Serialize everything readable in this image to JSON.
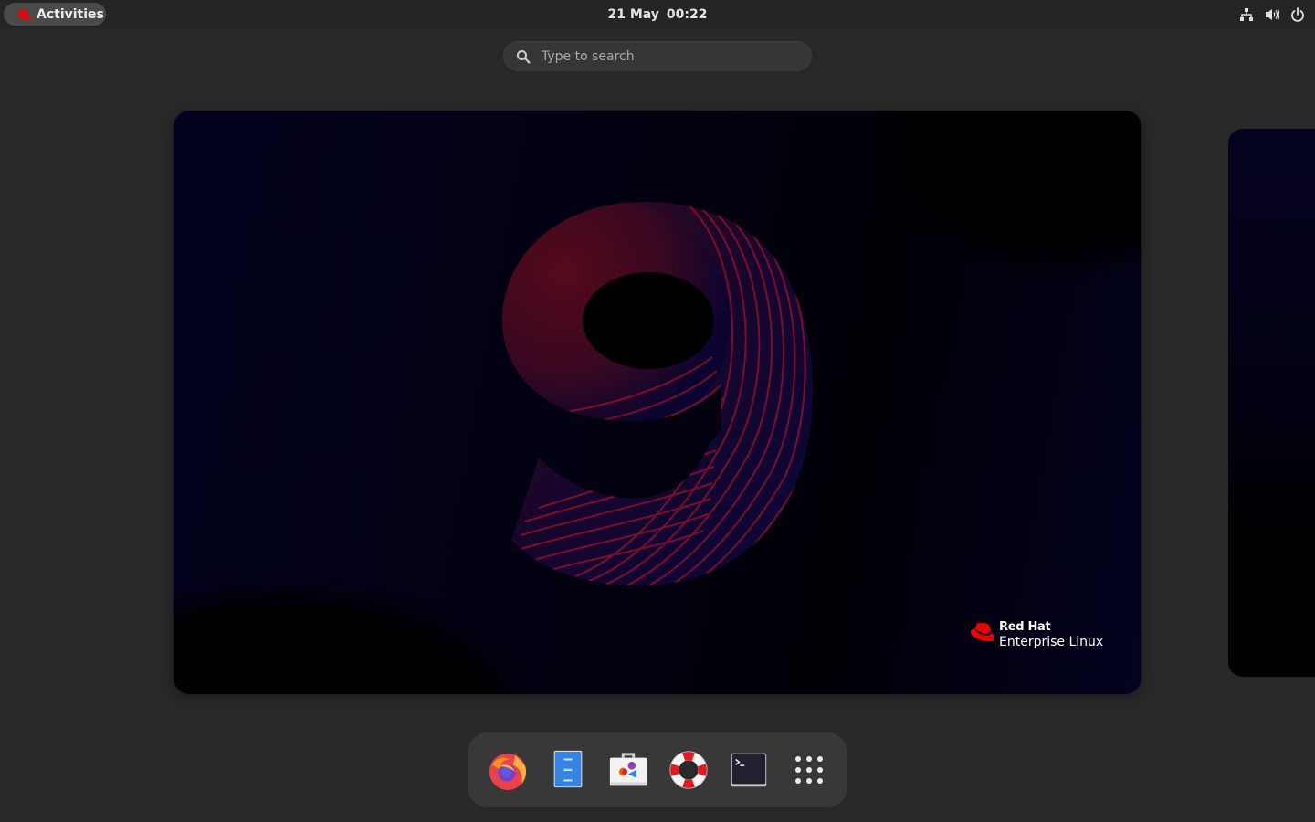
{
  "topbar": {
    "activities_label": "Activities",
    "date": "21 May",
    "time": "00:22",
    "tray_icons": [
      "network-icon",
      "volume-icon",
      "power-icon"
    ]
  },
  "search": {
    "placeholder": "Type to search",
    "value": ""
  },
  "workspace": {
    "wallpaper_label": "9",
    "brand_line1": "Red Hat",
    "brand_line2": "Enterprise Linux"
  },
  "dash": {
    "apps": [
      {
        "name": "Firefox",
        "icon": "firefox-icon"
      },
      {
        "name": "Files",
        "icon": "files-icon"
      },
      {
        "name": "Software",
        "icon": "software-icon"
      },
      {
        "name": "Help",
        "icon": "help-icon"
      },
      {
        "name": "Terminal",
        "icon": "terminal-icon"
      },
      {
        "name": "Show Applications",
        "icon": "app-grid-icon"
      }
    ]
  },
  "colors": {
    "brand_red": "#ee0000",
    "panel": "#252525",
    "background": "#282828"
  }
}
